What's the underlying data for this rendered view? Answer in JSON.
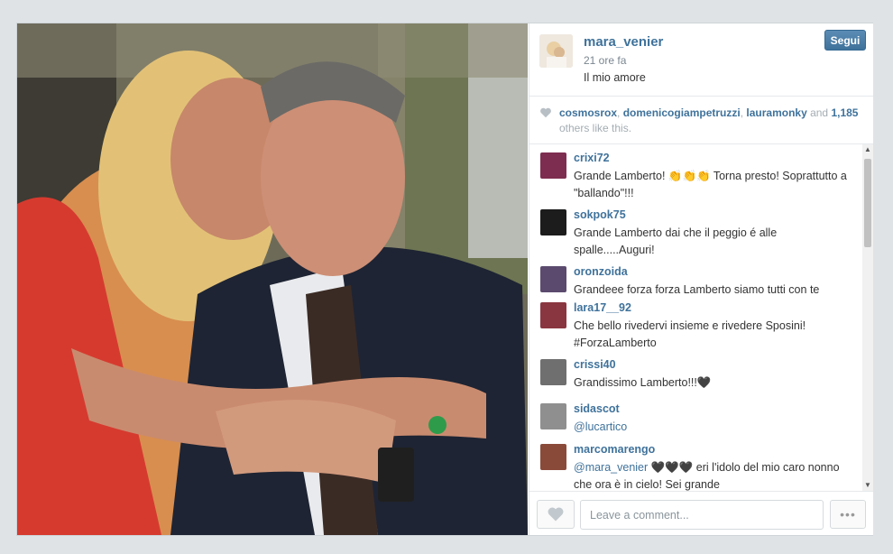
{
  "post": {
    "photo_description_icon": "photo",
    "owner": {
      "username": "mara_venier",
      "avatar_icon": "user-avatar"
    },
    "time": "21 ore fa",
    "caption": "Il mio amore",
    "follow_label": "Segui"
  },
  "likes": {
    "icon": "heart-icon",
    "users": [
      "cosmosrox",
      "domenicogiampetruzzi",
      "lauramonky"
    ],
    "separator": ", ",
    "and_text": " and ",
    "count": "1,185",
    "suffix": " others like this."
  },
  "comments": [
    {
      "user": "crixi72",
      "text": "Grande Lamberto! 👏👏👏 Torna presto! Soprattutto a \"ballando\"!!!",
      "avatar_color": "#7d2d4f"
    },
    {
      "user": "sokpok75",
      "text": "Grande Lamberto dai che il peggio é alle spalle.....Auguri!",
      "avatar_color": "#1c1c1c"
    },
    {
      "user": "oronzoida",
      "text": "Grandeee forza forza Lamberto siamo tutti con te",
      "avatar_color": "#5b4a6e"
    },
    {
      "user": "lara17__92",
      "text": "Che bello rivedervi insieme e rivedere Sposini! #ForzaLamberto",
      "avatar_color": "#8a3640"
    },
    {
      "user": "crissi40",
      "text": "Grandissimo Lamberto!!!🖤",
      "avatar_color": "#6f6f6f"
    },
    {
      "user": "sidascot",
      "text": "@lucartico",
      "avatar_color": "#8f8f8f"
    },
    {
      "user": "marcomarengo",
      "mention": "@mara_venier",
      "text": " 🖤🖤🖤 eri l'idolo del mio caro nonno che ora è in cielo! Sei grande",
      "avatar_color": "#8a4a3a"
    }
  ],
  "footer": {
    "like_icon": "heart-icon",
    "comment_placeholder": "Leave a comment...",
    "more_label": "•••"
  },
  "colors": {
    "link": "#3f729b",
    "follow": "#3f729b"
  }
}
